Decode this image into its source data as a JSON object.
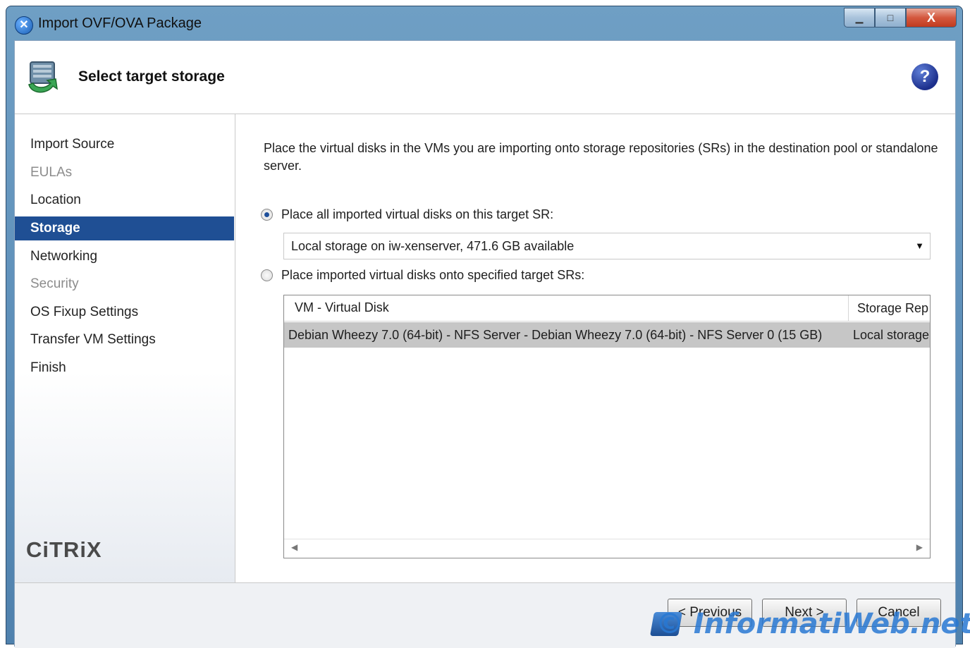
{
  "window": {
    "title": "Import OVF/OVA Package",
    "buttons": {
      "minimize": "▁",
      "maximize": "□",
      "close": "X"
    }
  },
  "header": {
    "title": "Select target storage",
    "help_label": "?"
  },
  "sidebar": {
    "items": [
      {
        "label": "Import Source",
        "state": "normal"
      },
      {
        "label": "EULAs",
        "state": "disabled"
      },
      {
        "label": "Location",
        "state": "normal"
      },
      {
        "label": "Storage",
        "state": "active"
      },
      {
        "label": "Networking",
        "state": "normal"
      },
      {
        "label": "Security",
        "state": "disabled"
      },
      {
        "label": "OS Fixup Settings",
        "state": "normal"
      },
      {
        "label": "Transfer VM Settings",
        "state": "normal"
      },
      {
        "label": "Finish",
        "state": "normal"
      }
    ],
    "logo": "CiTRiX"
  },
  "main": {
    "intro": "Place the virtual disks in the VMs you are importing onto storage repositories (SRs) in the destination pool or standalone server.",
    "option_all": {
      "label": "Place all imported virtual disks on this target SR:",
      "checked": true
    },
    "sr_select": {
      "value": "Local storage on iw-xenserver, 471.6 GB available"
    },
    "option_specified": {
      "label": "Place imported virtual disks onto specified target SRs:",
      "checked": false
    },
    "grid": {
      "columns": [
        "VM - Virtual Disk",
        "Storage Rep"
      ],
      "rows": [
        [
          "Debian Wheezy 7.0 (64-bit) - NFS Server - Debian Wheezy 7.0 (64-bit) - NFS Server 0 (15 GB)",
          "Local storage"
        ]
      ]
    }
  },
  "footer": {
    "previous": "< Previous",
    "next": "Next >",
    "cancel": "Cancel"
  },
  "watermark": "© InformatiWeb.net",
  "colors": {
    "selection": "#1f4f94",
    "row_selected": "#c6c6c6",
    "titlebar": "#5b8db8"
  }
}
